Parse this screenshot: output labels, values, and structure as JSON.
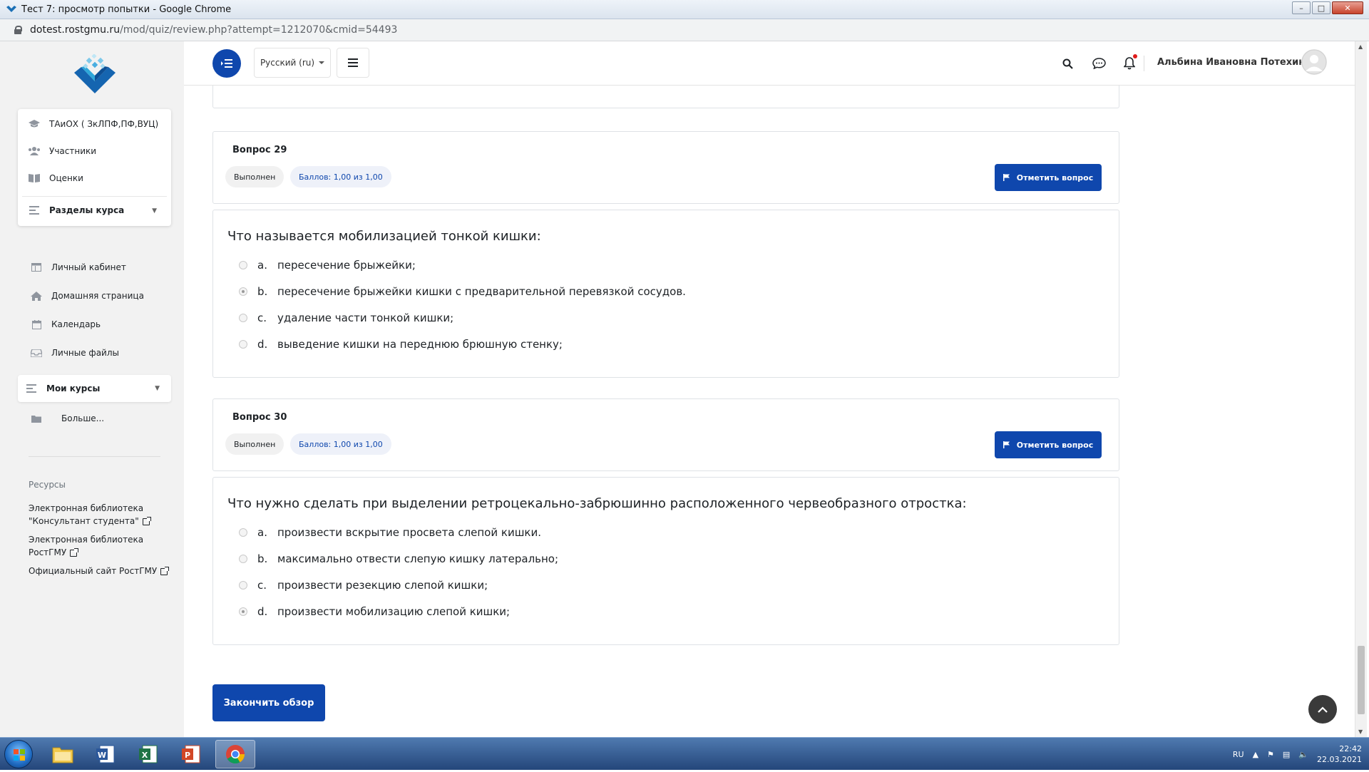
{
  "window": {
    "title": "Тест 7: просмотр попытки - Google Chrome",
    "url_domain": "dotest.rostgmu.ru",
    "url_path": "/mod/quiz/review.php?attempt=1212070&cmid=54493"
  },
  "sidebar": {
    "course_items": [
      {
        "label": "ТАиОХ ( ЗкЛПФ,ПФ,ВУЦ)",
        "icon": "graduation-cap-icon"
      },
      {
        "label": "Участники",
        "icon": "users-icon"
      },
      {
        "label": "Оценки",
        "icon": "book-icon"
      }
    ],
    "sections_label": "Разделы курса",
    "items": [
      {
        "label": "Личный кабинет",
        "icon": "dashboard-icon"
      },
      {
        "label": "Домашняя страница",
        "icon": "home-icon"
      },
      {
        "label": "Календарь",
        "icon": "calendar-icon"
      },
      {
        "label": "Личные файлы",
        "icon": "files-icon"
      }
    ],
    "my_courses_label": "Мои курсы",
    "more_label": "Больше...",
    "resources_title": "Ресурсы",
    "resources": [
      {
        "line1": "Электронная библиотека",
        "line2": "\"Консультант студента\""
      },
      {
        "line1": "Электронная библиотека",
        "line2": "РостГМУ"
      },
      {
        "line1": "Официальный сайт РостГМУ",
        "line2": ""
      }
    ]
  },
  "topbar": {
    "language": "Русский (ru)",
    "user_name": "Альбина Ивановна Потехина"
  },
  "questions": [
    {
      "number": "Вопрос 29",
      "state": "Выполнен",
      "grade": "Баллов: 1,00 из 1,00",
      "flag_label": "Отметить вопрос",
      "text": "Что называется мобилизацией тонкой кишки:",
      "options": [
        {
          "letter": "a.",
          "text": "пересечение брыжейки;",
          "selected": false
        },
        {
          "letter": "b.",
          "text": "пересечение брыжейки кишки с предварительной перевязкой сосудов.",
          "selected": true
        },
        {
          "letter": "c.",
          "text": "удаление части тонкой кишки;",
          "selected": false
        },
        {
          "letter": "d.",
          "text": "выведение кишки на переднюю брюшную стенку;",
          "selected": false
        }
      ]
    },
    {
      "number": "Вопрос 30",
      "state": "Выполнен",
      "grade": "Баллов: 1,00 из 1,00",
      "flag_label": "Отметить вопрос",
      "text": "Что нужно сделать при выделении ретроцекально-забрюшинно расположенного червеобразного отростка:",
      "options": [
        {
          "letter": "a.",
          "text": "произвести вскрытие просвета слепой кишки.",
          "selected": false
        },
        {
          "letter": "b.",
          "text": "максимально отвести слепую кишку латерально;",
          "selected": false
        },
        {
          "letter": "c.",
          "text": "произвести резекцию слепой кишки;",
          "selected": false
        },
        {
          "letter": "d.",
          "text": "произвести мобилизацию слепой кишки;",
          "selected": true
        }
      ]
    }
  ],
  "finish_label": "Закончить обзор",
  "taskbar": {
    "lang": "RU",
    "time": "22:42",
    "date": "22.03.2021"
  },
  "colors": {
    "brand": "#0f47ad",
    "sidebar_bg": "#f2f2f2",
    "notif": "#e01b1b"
  }
}
